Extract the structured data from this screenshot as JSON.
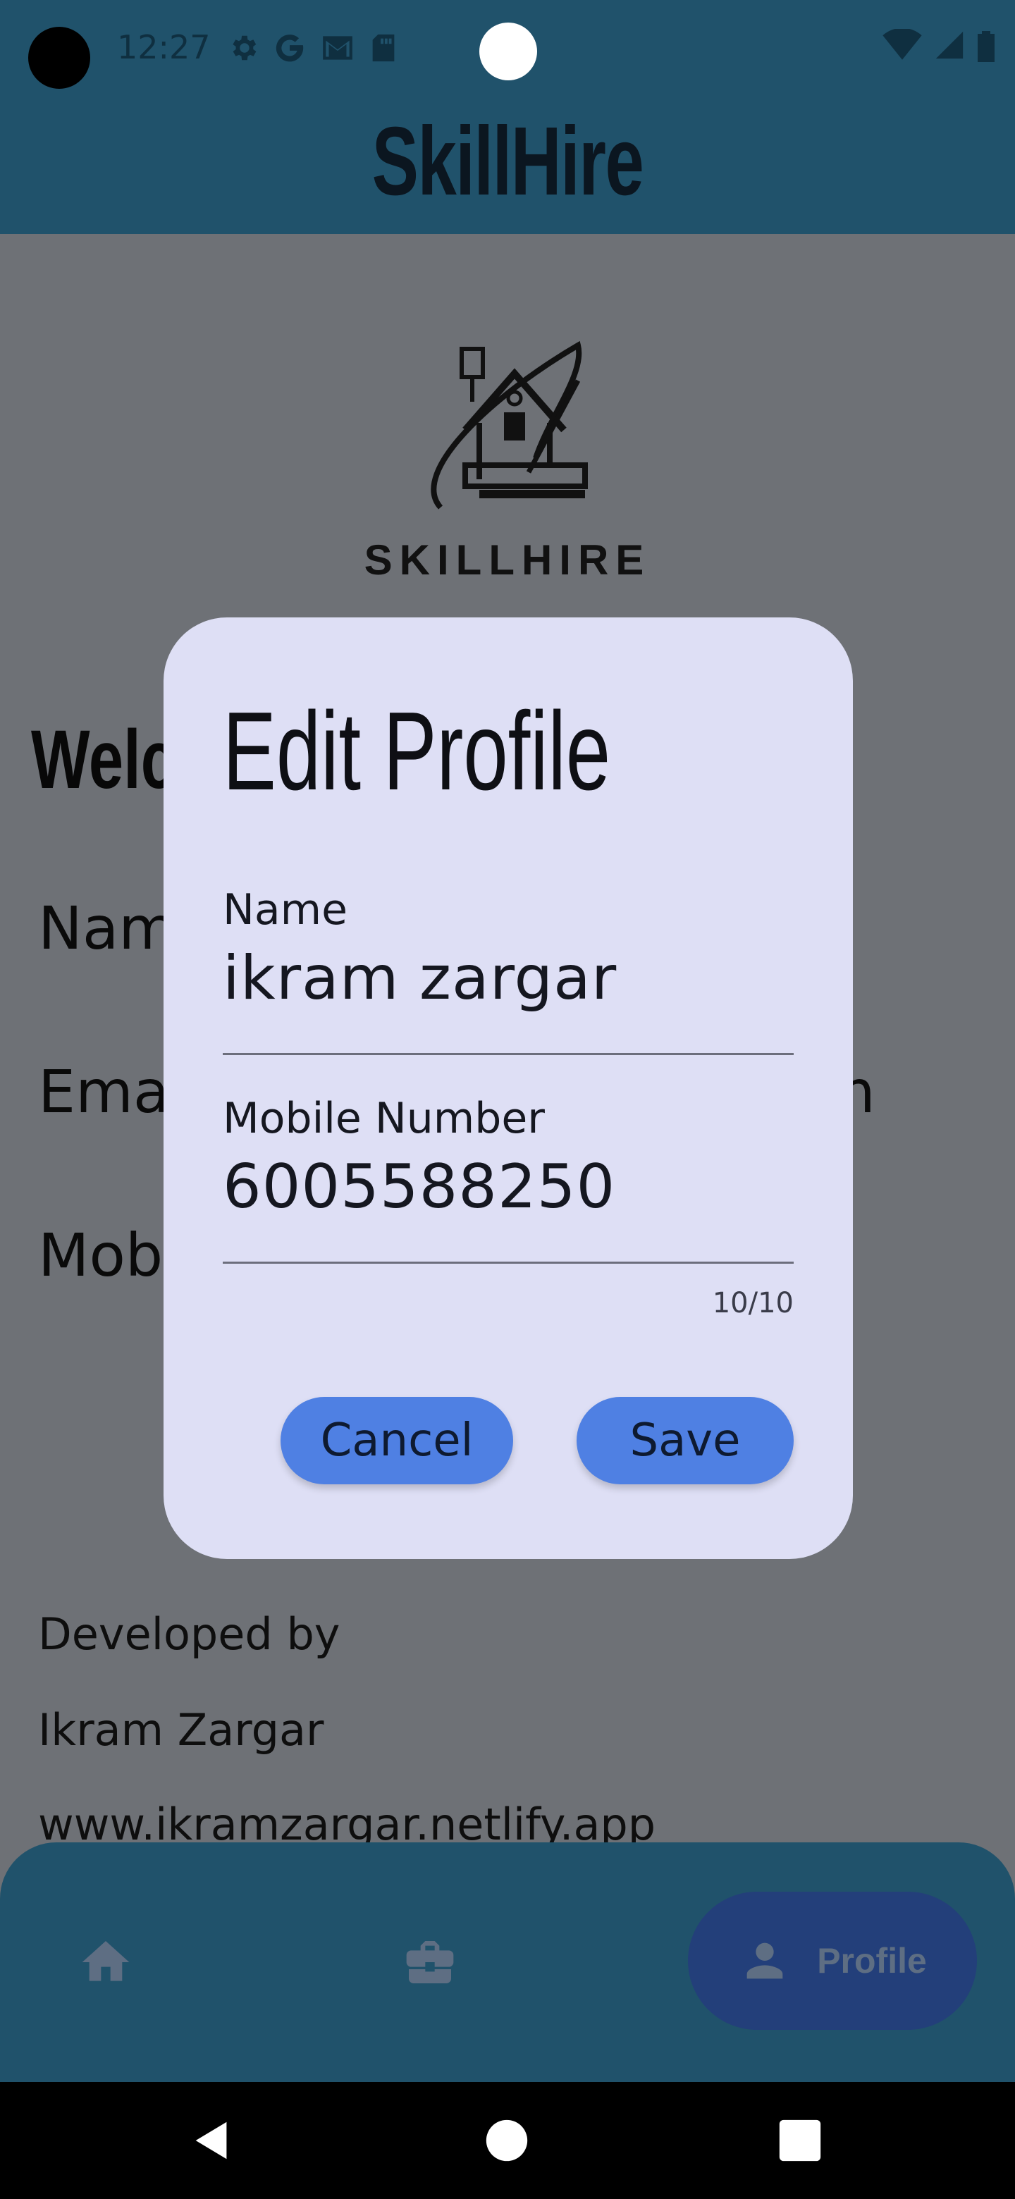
{
  "status_bar": {
    "time": "12:27"
  },
  "app_bar": {
    "title": "SkillHire"
  },
  "logo": {
    "wordmark": "SKILLHIRE"
  },
  "background": {
    "welcome_partial": "Welc",
    "name_partial": "Nam",
    "email_partial": "Ema",
    "email_tail": "m",
    "mobile_partial": "Mob"
  },
  "footer": {
    "developed_by": "Developed by",
    "developer": "Ikram Zargar",
    "website": "www.ikramzargar.netlify.app"
  },
  "dialog": {
    "title": "Edit Profile",
    "name_label": "Name",
    "name_value": "ikram zargar",
    "mobile_label": "Mobile Number",
    "mobile_value": "6005588250",
    "counter": "10/10",
    "cancel_label": "Cancel",
    "save_label": "Save"
  },
  "bottom_nav": {
    "items": [
      {
        "icon": "home-icon"
      },
      {
        "icon": "briefcase-icon"
      },
      {
        "icon": "person-icon",
        "label": "Profile",
        "selected": true
      }
    ]
  },
  "colors": {
    "app_bar": "#20526B",
    "dialog_bg": "#DEDFF5",
    "button": "#4F80E3",
    "scrim": "#6E7176"
  }
}
